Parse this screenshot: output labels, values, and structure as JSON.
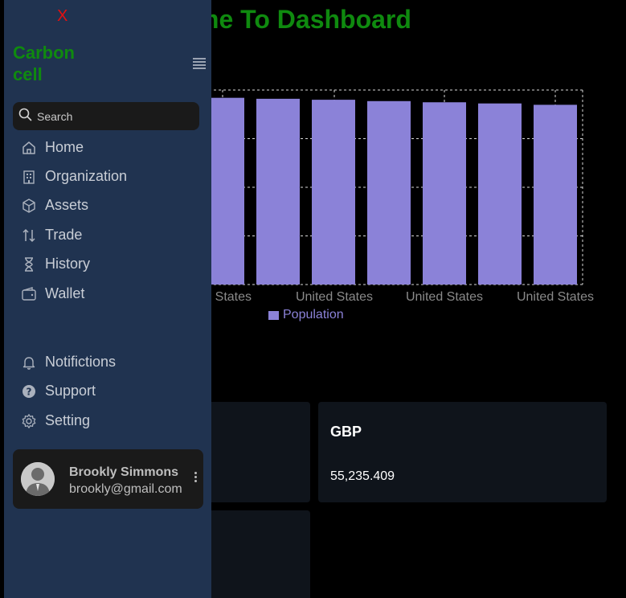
{
  "page": {
    "title": "elcome To Dashboard"
  },
  "chart_data": {
    "type": "bar",
    "categories": [
      "ted States",
      "United States",
      "United States",
      "United States",
      "United States",
      "United States",
      "United States"
    ],
    "tick_labels": [
      "ted States",
      "United States",
      "United States",
      "United States"
    ],
    "series": [
      {
        "name": "Population",
        "values": [
          96,
          95.5,
          95,
          94.3,
          93.7,
          93.1,
          92.4
        ]
      }
    ],
    "ylim": [
      0,
      100
    ],
    "grid": true,
    "legend": "bottom",
    "color": "#8b82d8"
  },
  "cards": [
    {
      "title": "",
      "value": ""
    },
    {
      "title": "GBP",
      "value": "55,235.409"
    },
    {
      "title": "",
      "value": ""
    }
  ],
  "sidebar": {
    "close_label": "X",
    "brand": "Carbon cell",
    "search_placeholder": "Search",
    "nav": [
      {
        "label": "Home",
        "icon": "home-icon"
      },
      {
        "label": "Organization",
        "icon": "building-icon"
      },
      {
        "label": "Assets",
        "icon": "cube-icon"
      },
      {
        "label": "Trade",
        "icon": "arrows-updown-icon"
      },
      {
        "label": "History",
        "icon": "hourglass-icon"
      },
      {
        "label": "Wallet",
        "icon": "wallet-icon"
      }
    ],
    "bottom_nav": [
      {
        "label": "Notifictions",
        "icon": "bell-icon"
      },
      {
        "label": "Support",
        "icon": "help-icon"
      },
      {
        "label": "Setting",
        "icon": "gear-icon"
      }
    ],
    "user": {
      "name": "Brookly Simmons",
      "email": "brookly@gmail.com"
    }
  },
  "colors": {
    "brand_green": "#0f8a0f",
    "sidebar_bg": "#203350",
    "bar": "#8b82d8",
    "close": "#e41010"
  }
}
